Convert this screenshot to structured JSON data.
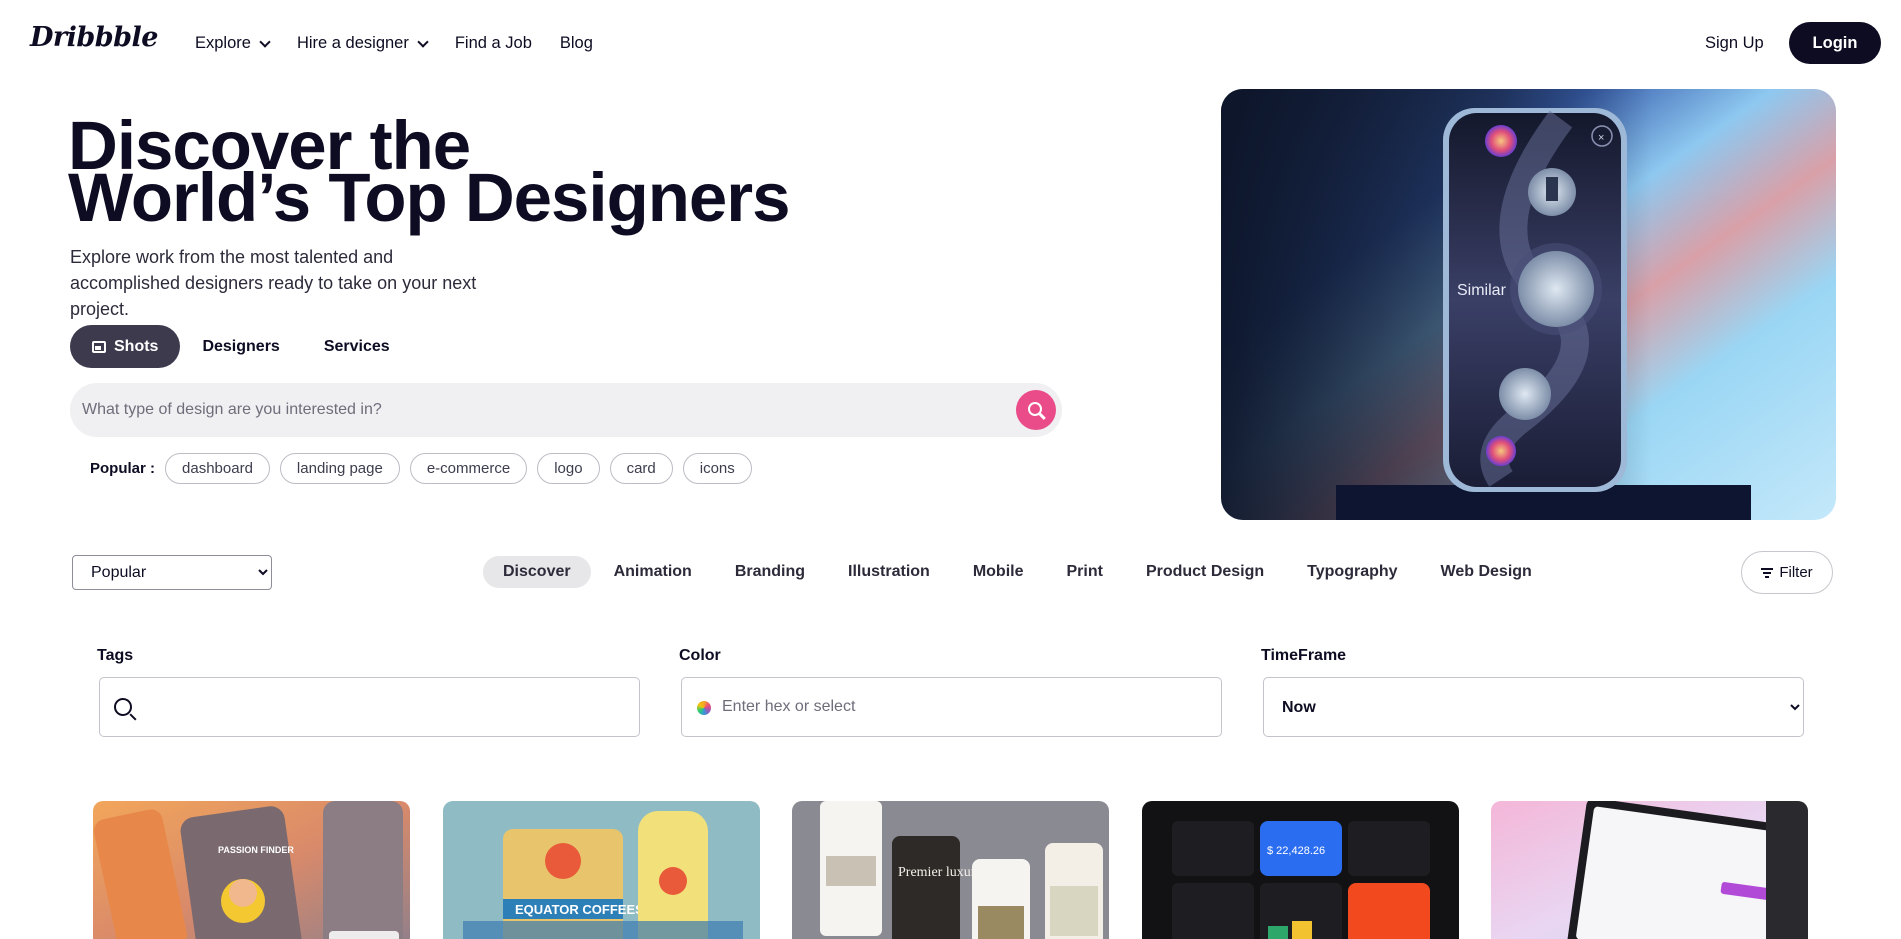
{
  "header": {
    "logo": "Dribbble",
    "nav": [
      {
        "label": "Explore",
        "dropdown": true
      },
      {
        "label": "Hire a designer",
        "dropdown": true
      },
      {
        "label": "Find a Job",
        "dropdown": false
      },
      {
        "label": "Blog",
        "dropdown": false
      }
    ],
    "signup_label": "Sign Up",
    "login_label": "Login"
  },
  "hero": {
    "title_line1": "Discover the",
    "title_line2": "World’s Top Designers",
    "subtitle": "Explore work from the most talented and accomplished designers ready to take on your next project.",
    "segments": [
      {
        "label": "Shots",
        "active": true
      },
      {
        "label": "Designers",
        "active": false
      },
      {
        "label": "Services",
        "active": false
      }
    ],
    "search_placeholder": "What type of design are you interested in?",
    "popular_label": "Popular :",
    "popular_tags": [
      "dashboard",
      "landing page",
      "e-commerce",
      "logo",
      "card",
      "icons"
    ],
    "image_caption": "Similar"
  },
  "filters": {
    "sort_options": [
      "Popular"
    ],
    "sort_selected": "Popular",
    "categories": [
      {
        "label": "Discover",
        "active": true
      },
      {
        "label": "Animation",
        "active": false
      },
      {
        "label": "Branding",
        "active": false
      },
      {
        "label": "Illustration",
        "active": false
      },
      {
        "label": "Mobile",
        "active": false
      },
      {
        "label": "Print",
        "active": false
      },
      {
        "label": "Product Design",
        "active": false
      },
      {
        "label": "Typography",
        "active": false
      },
      {
        "label": "Web Design",
        "active": false
      }
    ],
    "filter_label": "Filter",
    "tags_label": "Tags",
    "color_label": "Color",
    "color_placeholder": "Enter hex or select",
    "timeframe_label": "TimeFrame",
    "timeframe_selected": "Now"
  },
  "shots": [
    {
      "name": "passion-finder",
      "text": "PASSION FINDER"
    },
    {
      "name": "equator-coffees",
      "text": "EQUATOR COFFEES"
    },
    {
      "name": "luxury-retreat",
      "text": "Premier luxury retreat"
    },
    {
      "name": "finance-dashboard",
      "text": "$ 22,428.26"
    },
    {
      "name": "saas-laptop",
      "text": ""
    }
  ],
  "colors": {
    "accent_pink": "#ea4c89",
    "dark": "#0d0c22",
    "segment_active": "#3d3a4e"
  }
}
